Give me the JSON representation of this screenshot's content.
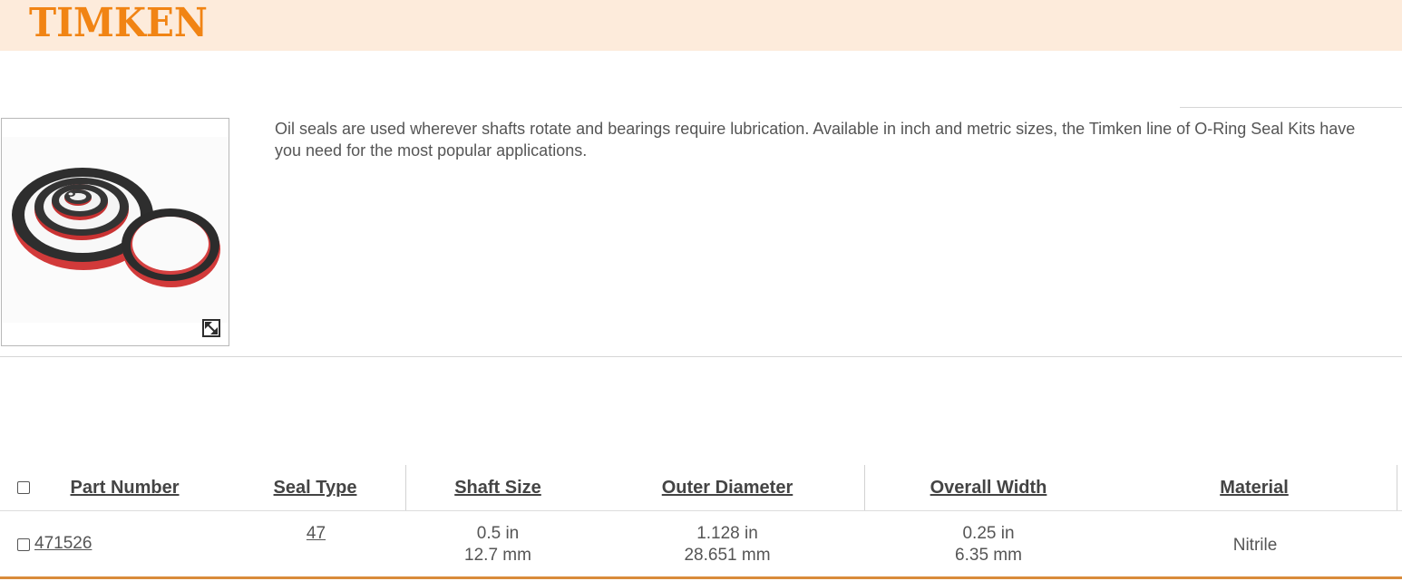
{
  "brand": {
    "logo_text": "TIMKEN",
    "accent_color": "#f18414",
    "header_bg": "#fdebdb"
  },
  "product": {
    "image_alt": "oil-seals-image",
    "expand_icon": "expand-icon",
    "description": "Oil seals are used wherever shafts rotate and bearings require lubrication. Available in inch and metric sizes, the Timken line of O-Ring Seal Kits have\nyou need for the most popular applications."
  },
  "table": {
    "headers": {
      "part_number": "Part Number",
      "seal_type": "Seal Type",
      "shaft_size": "Shaft Size",
      "outer_diameter": "Outer Diameter",
      "overall_width": "Overall Width",
      "material": "Material"
    },
    "rows": [
      {
        "part_number": "471526",
        "seal_type": "47",
        "shaft_size_in": "0.5 in",
        "shaft_size_mm": "12.7 mm",
        "outer_diameter_in": "1.128 in",
        "outer_diameter_mm": "28.651 mm",
        "overall_width_in": "0.25 in",
        "overall_width_mm": "6.35 mm",
        "material": "Nitrile"
      }
    ]
  }
}
